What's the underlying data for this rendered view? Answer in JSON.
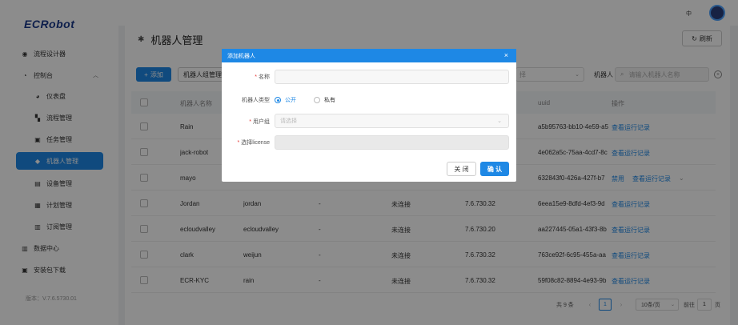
{
  "app": {
    "logo": "ECRobot",
    "version": "版本：V.7.6.5730.01"
  },
  "header": {
    "lang": "中"
  },
  "sidebar": {
    "items": [
      {
        "label": "流程设计器",
        "icon": "compass-icon"
      },
      {
        "label": "控制台",
        "icon": "dashboard-icon"
      },
      {
        "label": "仪表盘",
        "icon": "pie-icon"
      },
      {
        "label": "流程管理",
        "icon": "flow-icon"
      },
      {
        "label": "任务管理",
        "icon": "task-icon"
      },
      {
        "label": "机器人管理",
        "icon": "robot-icon"
      },
      {
        "label": "设备管理",
        "icon": "device-icon"
      },
      {
        "label": "计划管理",
        "icon": "plan-icon"
      },
      {
        "label": "订阅管理",
        "icon": "subscribe-icon"
      },
      {
        "label": "数据中心",
        "icon": "bar-chart-icon"
      },
      {
        "label": "安装包下载",
        "icon": "download-icon"
      }
    ]
  },
  "page": {
    "title": "机器人管理",
    "refresh_label": "刷新",
    "add_label": "添加",
    "group_label": "机器人组管理",
    "filter_select_suffix": "择",
    "filter_label": "机器人",
    "search_placeholder": "请输入机器人名称"
  },
  "table": {
    "headers": {
      "name": "机器人名称",
      "uuid": "uuid",
      "op": "操作"
    },
    "rows": [
      {
        "name": "Rain",
        "user": "",
        "dash": "",
        "status": "",
        "version": "",
        "uuid": "a5b95763-bb10-4e59-a5",
        "ops": [
          "查看运行记录"
        ]
      },
      {
        "name": "jack-robot",
        "user": "",
        "dash": "",
        "status": "",
        "version": "",
        "uuid": "4e062a5c-75aa-4cd7-8c",
        "ops": [
          "查看运行记录"
        ]
      },
      {
        "name": "mayo",
        "user": "",
        "dash": "",
        "status": "",
        "version": "",
        "uuid": "632843f0-426a-427f-b7",
        "ops": [
          "禁用",
          "查看运行记录"
        ]
      },
      {
        "name": "Jordan",
        "user": "jordan",
        "dash": "-",
        "status": "未连接",
        "version": "7.6.730.32",
        "uuid": "6eea15e9-8dfd-4ef3-9d",
        "ops": [
          "查看运行记录"
        ]
      },
      {
        "name": "ecloudvalley",
        "user": "ecloudvalley",
        "dash": "-",
        "status": "未连接",
        "version": "7.6.730.20",
        "uuid": "aa227445-05a1-43f3-8b",
        "ops": [
          "查看运行记录"
        ]
      },
      {
        "name": "clark",
        "user": "weijun",
        "dash": "-",
        "status": "未连接",
        "version": "7.6.730.32",
        "uuid": "763ce92f-6c95-455a-aa",
        "ops": [
          "查看运行记录"
        ]
      },
      {
        "name": "ECR-KYC",
        "user": "rain",
        "dash": "-",
        "status": "未连接",
        "version": "7.6.730.32",
        "uuid": "59f08c82-8894-4e93-9b",
        "ops": [
          "查看运行记录"
        ]
      }
    ]
  },
  "pagination": {
    "total": "共 9 条",
    "page": "1",
    "page_size": "10条/页",
    "goto": "前往",
    "goto_value": "1",
    "unit": "页"
  },
  "modal": {
    "title": "添加机器人",
    "name_label": "名称",
    "type_label": "机器人类型",
    "type_public": "公开",
    "type_private": "私有",
    "group_label": "用户组",
    "group_placeholder": "请选择",
    "license_label": "选择license",
    "cancel_label": "关 闭",
    "ok_label": "确 认"
  },
  "colors": {
    "accent": "#1e88e5",
    "overlay": "rgba(0,0,0,0.45)"
  }
}
